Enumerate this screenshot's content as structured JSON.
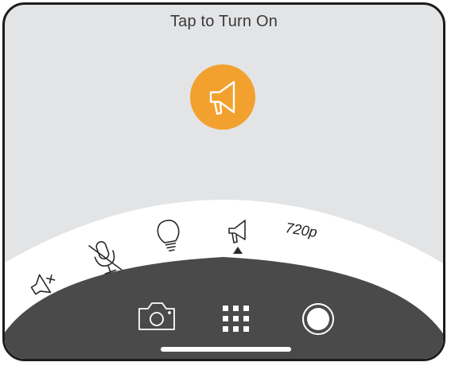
{
  "prompt": {
    "title": "Tap to Turn On"
  },
  "modes": [
    {
      "icon": "speaker-mute-icon",
      "label": ""
    },
    {
      "icon": "microphone-off-icon",
      "label": ""
    },
    {
      "icon": "light-bulb-icon",
      "label": ""
    },
    {
      "icon": "megaphone-icon",
      "label": "",
      "selected": true
    },
    {
      "icon": "",
      "label": "720p"
    }
  ],
  "bottom_bar": {
    "items": [
      "camera-icon",
      "grid-icon",
      "record-icon"
    ]
  },
  "colors": {
    "background": "#e3e4e6",
    "accent": "#f2a12e",
    "dial": "#ffffff",
    "bar": "#4a4a4a",
    "icon_light": "#ffffff",
    "icon_dark": "#2a2a2a"
  }
}
